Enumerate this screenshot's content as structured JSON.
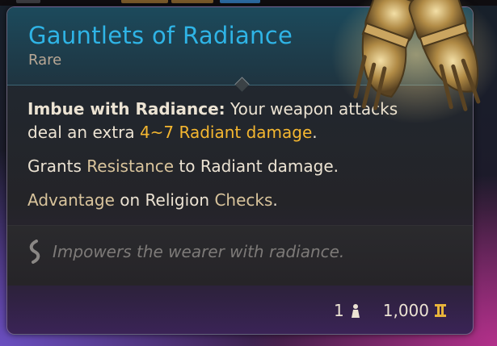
{
  "item": {
    "name": "Gauntlets of Radiance",
    "rarity": "Rare"
  },
  "properties": {
    "imbue": {
      "label": "Imbue with Radiance:",
      "text_before": " Your weapon attacks deal an extra ",
      "damage": "4~7 Radiant damage",
      "text_after": "."
    },
    "resistance": {
      "prefix": "Grants ",
      "keyword": "Resistance",
      "suffix": " to Radiant damage."
    },
    "advantage": {
      "keyword": "Advantage",
      "middle": " on Religion ",
      "keyword2": "Checks",
      "suffix": "."
    }
  },
  "flavor_text": "Impowers the wearer with radiance.",
  "footer": {
    "weight": "1",
    "weight_icon": "weight-icon",
    "value": "1,000",
    "value_icon": "gold-icon"
  },
  "colors": {
    "title": "#2fb4e6",
    "rarity": "#b9a895",
    "damage_highlight": "#f5b730",
    "keyword_highlight": "#d9c49c",
    "flavor": "#7d7a78"
  }
}
